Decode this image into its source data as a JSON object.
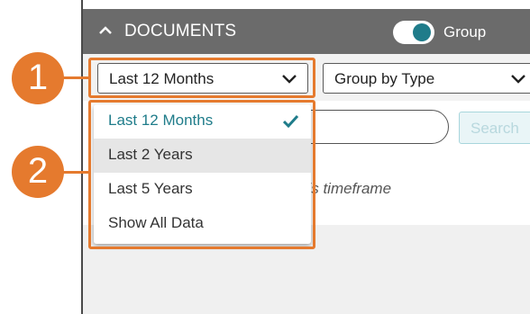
{
  "header": {
    "title": "DOCUMENTS",
    "toggle_label": "Group",
    "toggle_on": true,
    "collapse_icon": "chevron-up-icon"
  },
  "filters": {
    "timeframe": {
      "selected": "Last 12 Months",
      "icon": "chevron-down-icon"
    },
    "grouping": {
      "selected": "Group by Type",
      "icon": "chevron-down-icon"
    }
  },
  "search": {
    "placeholder": "",
    "button_label": "Search"
  },
  "empty_message": "his timeframe",
  "timeframe_menu": {
    "options": [
      {
        "label": "Last 12 Months",
        "selected": true
      },
      {
        "label": "Last 2 Years",
        "selected": false
      },
      {
        "label": "Last 5 Years",
        "selected": false
      },
      {
        "label": "Show All Data",
        "selected": false
      }
    ],
    "check_icon": "checkmark-icon"
  },
  "callouts": [
    {
      "number": "1"
    },
    {
      "number": "2"
    }
  ],
  "colors": {
    "accent": "#1f7c8a",
    "callout": "#e57a2e",
    "header_bg": "#6b6b6b"
  }
}
